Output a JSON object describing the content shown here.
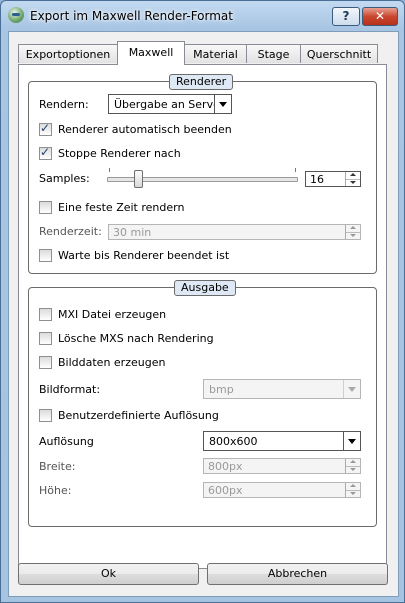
{
  "window": {
    "title": "Export im Maxwell Render-Format",
    "help_label": "?",
    "close_label": "✕"
  },
  "tabs": [
    {
      "label": "Exportoptionen",
      "active": false
    },
    {
      "label": "Maxwell",
      "active": true
    },
    {
      "label": "Material",
      "active": false
    },
    {
      "label": "Stage",
      "active": false
    },
    {
      "label": "Querschnitt",
      "active": false
    }
  ],
  "renderer": {
    "title": "Renderer",
    "rendern_label": "Rendern:",
    "rendern_value": "Übergabe an Server",
    "auto_close_label": "Renderer automatisch beenden",
    "auto_close_checked": true,
    "stop_after_label": "Stoppe Renderer nach",
    "stop_after_checked": true,
    "samples_label": "Samples:",
    "samples_value": "16",
    "fixed_time_label": "Eine feste Zeit rendern",
    "fixed_time_checked": false,
    "render_time_label": "Renderzeit:",
    "render_time_value": "30 min",
    "wait_label": "Warte bis Renderer beendet ist",
    "wait_checked": false
  },
  "output": {
    "title": "Ausgabe",
    "mxi_label": "MXI Datei erzeugen",
    "mxi_checked": false,
    "delete_mxs_label": "Lösche MXS nach Rendering",
    "delete_mxs_checked": false,
    "image_data_label": "Bilddaten erzeugen",
    "image_data_checked": false,
    "format_label": "Bildformat:",
    "format_value": "bmp",
    "custom_res_label": "Benutzerdefinierte Auflösung",
    "custom_res_checked": false,
    "resolution_label": "Auflösung",
    "resolution_value": "800x600",
    "width_label": "Breite:",
    "width_value": "800px",
    "height_label": "Höhe:",
    "height_value": "600px"
  },
  "buttons": {
    "ok_label": "Ok",
    "cancel_label": "Abbrechen"
  }
}
